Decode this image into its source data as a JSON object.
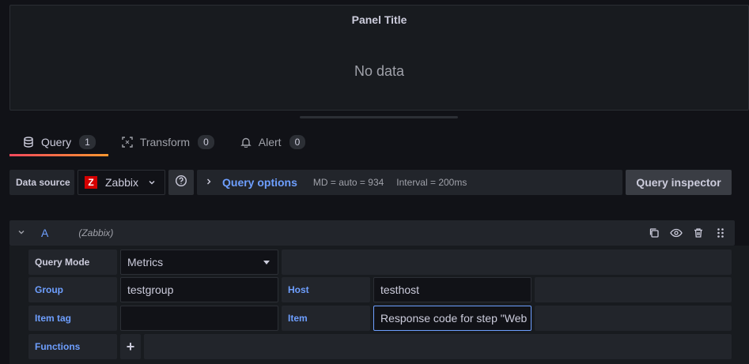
{
  "panel": {
    "title": "Panel Title",
    "empty_text": "No data"
  },
  "tabs": [
    {
      "label": "Query",
      "count": "1",
      "icon": "database-icon"
    },
    {
      "label": "Transform",
      "count": "0",
      "icon": "transform-icon"
    },
    {
      "label": "Alert",
      "count": "0",
      "icon": "bell-icon"
    }
  ],
  "toolbar": {
    "datasource_label": "Data source",
    "datasource_logo_letter": "Z",
    "datasource_name": "Zabbix",
    "query_options_label": "Query options",
    "md_info": "MD = auto = 934",
    "interval_info": "Interval = 200ms",
    "inspector_label": "Query inspector"
  },
  "query": {
    "ref_id": "A",
    "datasource": "(Zabbix)",
    "query_mode_label": "Query Mode",
    "query_mode_value": "Metrics",
    "group_label": "Group",
    "group_value": "testgroup",
    "host_label": "Host",
    "host_value": "testhost",
    "item_tag_label": "Item tag",
    "item_tag_value": "",
    "item_label": "Item",
    "item_value": "Response code for step \"Web",
    "functions_label": "Functions",
    "add_function_label": "+"
  },
  "colors": {
    "background": "#111217",
    "panel": "#181b1f",
    "accent_blue": "#6e9fff",
    "tab_underline_start": "#f2495c",
    "tab_underline_end": "#ff9830",
    "zabbix_red": "#d40000"
  }
}
